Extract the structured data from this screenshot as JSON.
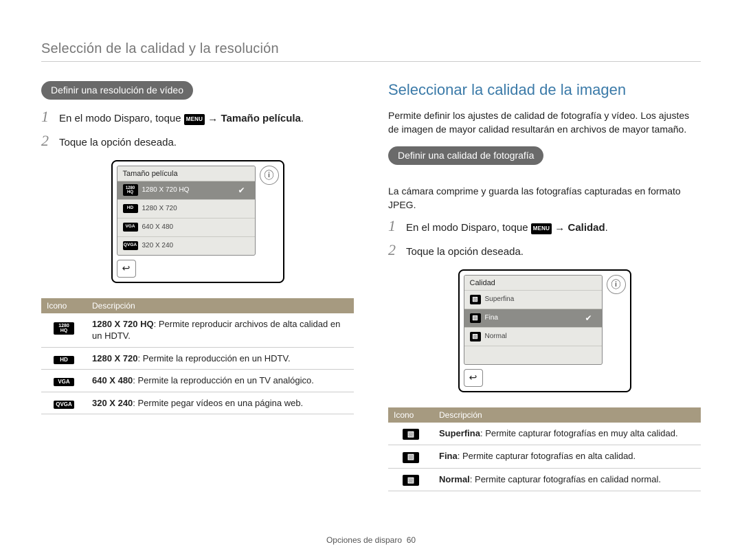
{
  "section_title": "Selección de la calidad y la resolución",
  "left": {
    "pill": "Definir una resolución de vídeo",
    "steps": [
      {
        "num": "1",
        "pre": "En el modo Disparo, toque ",
        "chip": "MENU",
        "arrow": " → ",
        "bold": "Tamaño película",
        "post": "."
      },
      {
        "num": "2",
        "text": "Toque la opción deseada."
      }
    ],
    "shot": {
      "title": "Tamaño película",
      "rows": [
        {
          "icon_top": "1280",
          "icon_bot": "HQ",
          "stack": true,
          "label": "1280 X 720 HQ",
          "selected": true
        },
        {
          "icon": "HD",
          "label": "1280 X 720"
        },
        {
          "icon": "VGA",
          "label": "640 X 480"
        },
        {
          "icon": "QVGA",
          "label": "320 X 240"
        }
      ]
    },
    "table": {
      "h_icon": "Icono",
      "h_desc": "Descripción",
      "rows": [
        {
          "icon_top": "1280",
          "icon_bot": "HQ",
          "stack": true,
          "bold": "1280 X 720 HQ",
          "rest": ": Permite reproducir archivos de alta calidad en un HDTV."
        },
        {
          "icon": "HD",
          "bold": "1280 X 720",
          "rest": ": Permite la reproducción en un HDTV."
        },
        {
          "icon": "VGA",
          "bold": "640 X 480",
          "rest": ": Permite la reproducción en un TV analógico."
        },
        {
          "icon": "QVGA",
          "bold": "320 X 240",
          "rest": ": Permite pegar vídeos en una página web."
        }
      ]
    }
  },
  "right": {
    "heading": "Seleccionar la calidad de la imagen",
    "intro": "Permite definir los ajustes de calidad de fotografía y vídeo. Los ajustes de imagen de mayor calidad resultarán en archivos de mayor tamaño.",
    "pill": "Definir una calidad de fotografía",
    "sub": "La cámara comprime y guarda las fotografías capturadas en formato JPEG.",
    "steps": [
      {
        "num": "1",
        "pre": "En el modo Disparo, toque ",
        "chip": "MENU",
        "arrow": " → ",
        "bold": "Calidad",
        "post": "."
      },
      {
        "num": "2",
        "text": "Toque la opción deseada."
      }
    ],
    "shot": {
      "title": "Calidad",
      "rows": [
        {
          "glyph": "▧",
          "sub": "SF",
          "label": "Superfina"
        },
        {
          "glyph": "▧",
          "sub": "F",
          "label": "Fina",
          "selected": true
        },
        {
          "glyph": "▧",
          "sub": "N",
          "label": "Normal"
        }
      ]
    },
    "table": {
      "h_icon": "Icono",
      "h_desc": "Descripción",
      "rows": [
        {
          "glyph": "▧",
          "sub": "SF",
          "bold": "Superfina",
          "rest": ": Permite capturar fotografías en muy alta calidad."
        },
        {
          "glyph": "▧",
          "sub": "F",
          "bold": "Fina",
          "rest": ": Permite capturar fotografías en alta calidad."
        },
        {
          "glyph": "▧",
          "sub": "N",
          "bold": "Normal",
          "rest": ": Permite capturar fotografías en calidad normal."
        }
      ]
    }
  },
  "footer": {
    "label": "Opciones de disparo",
    "page": "60"
  }
}
